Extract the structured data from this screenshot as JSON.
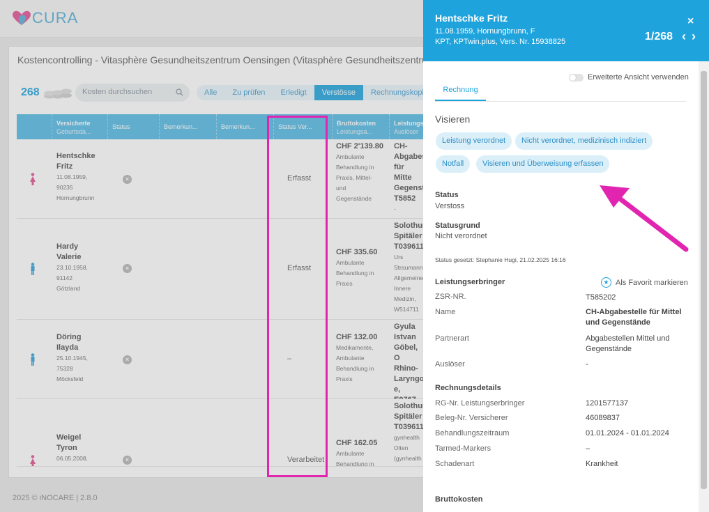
{
  "app": {
    "logo_text": "CURA",
    "footer": "2025 © iNOCARE | 2.8.0"
  },
  "list": {
    "title": "Kostencontrolling - Vitasphère Gesundheitszentrum Oensingen (Vitasphère Gesundheitszentrum Oensingen)",
    "count": "268",
    "search_placeholder": "Kosten durchsuchen",
    "filters": [
      "Alle",
      "Zu prüfen",
      "Erledigt",
      "Verstösse",
      "Rechnungskopie"
    ],
    "active_filter": "Verstösse",
    "columns": {
      "versicherte": {
        "main": "Versicherte",
        "sub": "Geburtsda..."
      },
      "status": "Status",
      "bemerkung1": "Bemerkun...",
      "bemerkung2": "Bemerkun...",
      "status_ver": "Status Ver...",
      "brutto": {
        "main": "Bruttokosten",
        "sub": "Leistungsa..."
      },
      "leistung": {
        "main": "Leistungs...",
        "sub": "Auslöser"
      }
    },
    "rows": [
      {
        "first": "Hentschke",
        "last": "Fritz",
        "d1": "11.08.1959,",
        "d2": "90235",
        "d3": "Hornungbrunn",
        "gender": "f",
        "status_ver": "Erfasst",
        "amount": "CHF 2'139.80",
        "bl": [
          "Ambulante",
          "Behandlung in",
          "Praxis, Mittel-",
          "und",
          "Gegenstände"
        ],
        "prov": [
          "CH-",
          "Abgabes",
          "für Mitte",
          "Gegensta",
          "T5852"
        ],
        "prov_sub": [
          "-"
        ]
      },
      {
        "first": "Hardy",
        "last": "Valerie",
        "d1": "23.10.1958,",
        "d2": "91142",
        "d3": "Götzland",
        "gender": "m",
        "status_ver": "Erfasst",
        "amount": "CHF 335.60",
        "bl": [
          "Ambulante",
          "Behandlung in",
          "Praxis"
        ],
        "prov": [
          "Solothur",
          "Spitäler",
          "T039611"
        ],
        "prov_sub": [
          "Urs",
          "Straumann",
          "Allgemeine",
          "Innere",
          "Medizin,",
          "W514711"
        ]
      },
      {
        "first": "Döring",
        "last": "Ilayda",
        "d1": "25.10.1945,",
        "d2": "75328",
        "d3": "Möcksfeld",
        "gender": "m",
        "status_ver": "–",
        "amount": "CHF 132.00",
        "bl": [
          "Medikamente,",
          "Ambulante",
          "Behandlung in",
          "Praxis"
        ],
        "prov": [
          "Gyula",
          "Istvan",
          "Göbel, O",
          "Rhino-",
          "Laryngol",
          "e, E0767"
        ],
        "prov_sub": [
          "-"
        ]
      },
      {
        "first": "Weigel",
        "last": "Tyron",
        "d1": "06.05.2008,",
        "d2": "",
        "d3": "",
        "gender": "f",
        "status_ver": "Verarbeitet",
        "amount": "CHF 162.05",
        "bl": [
          "Ambulante",
          "Behandlung in"
        ],
        "prov": [
          "Solothur",
          "Spitäler",
          "T039611"
        ],
        "prov_sub": [
          "gynhealth",
          "Olten",
          "(gynhealth"
        ]
      }
    ]
  },
  "panel": {
    "name": "Hentschke Fritz",
    "line1": "11.08.1959, Hornungbrunn, F",
    "line2": "KPT, KPTwin.plus, Vers. Nr. 15938825",
    "pager": "1/268",
    "close": "×",
    "toggle_label": "Erweiterte Ansicht verwenden",
    "tab": "Rechnung",
    "visieren_title": "Visieren",
    "chips": [
      "Leistung verordnet",
      "Nicht verordnet, medizinisch indiziert",
      "Notfall",
      "Visieren und Überweisung erfassen"
    ],
    "status_label": "Status",
    "status_value": "Verstoss",
    "statusgrund_label": "Statusgrund",
    "statusgrund_value": "Nicht verordnet",
    "status_set": "Status gesetzt: Stephanie Hugi, 21.02.2025 16:16",
    "le_title": "Leistungserbringer",
    "favorite": "Als Favorit markieren",
    "le_rows": [
      {
        "k": "ZSR-NR.",
        "v": "T585202"
      },
      {
        "k": "Name",
        "v": "CH-Abgabestelle für Mittel und Gegenstände"
      },
      {
        "k": "Partnerart",
        "v": "Abgabestellen Mittel und Gegenstände"
      },
      {
        "k": "Auslöser",
        "v": "-"
      }
    ],
    "rd_title": "Rechnungsdetails",
    "rd_rows": [
      {
        "k": "RG-Nr. Leistungserbringer",
        "v": "1201577137"
      },
      {
        "k": "Beleg-Nr. Versicherer",
        "v": "46089837"
      },
      {
        "k": "Behandlungszeitraum",
        "v": "01.01.2024 - 01.01.2024"
      },
      {
        "k": "Tarmed-Markers",
        "v": "–"
      },
      {
        "k": "Schadenart",
        "v": "Krankheit"
      }
    ],
    "brutto_title": "Bruttokosten"
  },
  "colors": {
    "accent": "#1fa3dc",
    "table_header": "#5bbde6",
    "annotation": "#e225b0",
    "female": "#e25a9a",
    "male": "#3aa4dc"
  }
}
